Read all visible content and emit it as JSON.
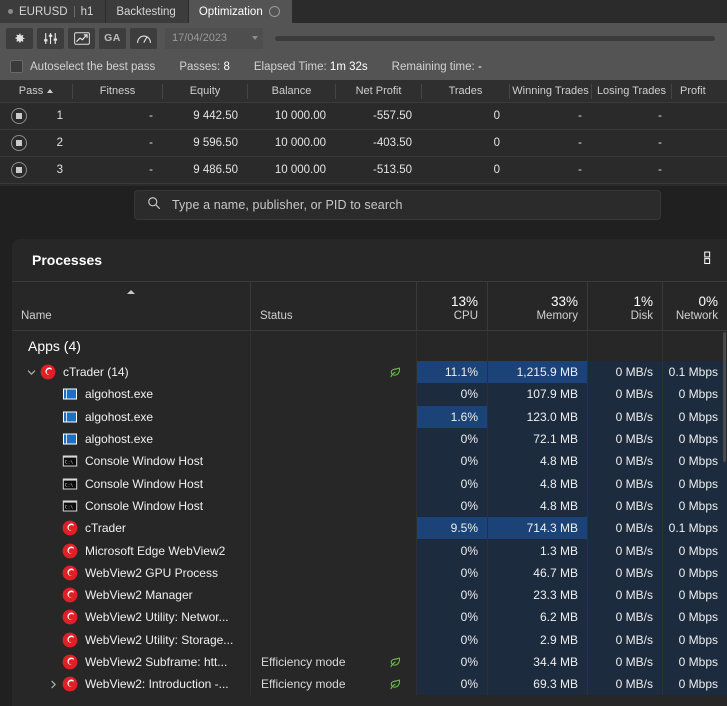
{
  "ctrader": {
    "tabs": [
      {
        "label": "EURUSD",
        "sub": "h1",
        "type": "symbol",
        "active": false
      },
      {
        "label": "Backtesting",
        "active": false
      },
      {
        "label": "Optimization",
        "active": true,
        "spinner": true
      }
    ],
    "toolbar": {
      "buttons": [
        {
          "name": "settings-button",
          "icon": "gear-icon",
          "label": ""
        },
        {
          "name": "parameters-button",
          "icon": "sliders-icon",
          "label": ""
        },
        {
          "name": "chart-button",
          "icon": "chart-line-icon",
          "label": ""
        },
        {
          "name": "ga-button",
          "icon": "text-icon",
          "label": "GA"
        },
        {
          "name": "gauge-button",
          "icon": "gauge-icon",
          "label": ""
        }
      ],
      "date_value": "17/04/2023"
    },
    "status": {
      "autoselect_label": "Autoselect the best pass",
      "passes_label": "Passes:",
      "passes_value": "8",
      "elapsed_label": "Elapsed Time:",
      "elapsed_value": "1m 32s",
      "remaining_label": "Remaining time:",
      "remaining_value": "-"
    },
    "table": {
      "columns": [
        "Pass",
        "Fitness",
        "Equity",
        "Balance",
        "Net Profit",
        "Trades",
        "Winning Trades",
        "Losing Trades",
        "Profit"
      ],
      "sort_column": "Pass",
      "sort_direction": "ascending",
      "rows": [
        {
          "pass": "1",
          "fitness": "-",
          "equity": "9 442.50",
          "balance": "10 000.00",
          "net_profit": "-557.50",
          "trades": "0",
          "winning_trades": "-",
          "losing_trades": "-",
          "profit": ""
        },
        {
          "pass": "2",
          "fitness": "-",
          "equity": "9 596.50",
          "balance": "10 000.00",
          "net_profit": "-403.50",
          "trades": "0",
          "winning_trades": "-",
          "losing_trades": "-",
          "profit": ""
        },
        {
          "pass": "3",
          "fitness": "-",
          "equity": "9 486.50",
          "balance": "10 000.00",
          "net_profit": "-513.50",
          "trades": "0",
          "winning_trades": "-",
          "losing_trades": "-",
          "profit": ""
        }
      ]
    }
  },
  "taskmanager": {
    "search": {
      "placeholder": "Type a name, publisher, or PID to search",
      "value": ""
    },
    "panel_title": "Processes",
    "columns": [
      {
        "key": "name",
        "label": "Name",
        "pct": ""
      },
      {
        "key": "status",
        "label": "Status",
        "pct": ""
      },
      {
        "key": "cpu",
        "label": "CPU",
        "pct": "13%"
      },
      {
        "key": "memory",
        "label": "Memory",
        "pct": "33%"
      },
      {
        "key": "disk",
        "label": "Disk",
        "pct": "1%"
      },
      {
        "key": "network",
        "label": "Network",
        "pct": "0%"
      }
    ],
    "rows": [
      {
        "type": "group",
        "name": "Apps (4)",
        "status": "",
        "cpu": "",
        "memory": "",
        "disk": "",
        "network": "",
        "cpu_hl": 0,
        "mem_hl": 0,
        "icon": "none",
        "indent": 0,
        "chevron": "none",
        "leaf": false
      },
      {
        "type": "process",
        "name": "cTrader (14)",
        "status": "",
        "cpu": "11.1%",
        "memory": "1,215.9 MB",
        "disk": "0 MB/s",
        "network": "0.1 Mbps",
        "cpu_hl": 3,
        "mem_hl": 3,
        "icon": "ctrader-icon",
        "indent": 0,
        "chevron": "expanded",
        "leaf": true
      },
      {
        "type": "process",
        "name": "algohost.exe",
        "status": "",
        "cpu": "0%",
        "memory": "107.9 MB",
        "disk": "0 MB/s",
        "network": "0 Mbps",
        "cpu_hl": 1,
        "mem_hl": 1,
        "icon": "app-window-icon",
        "indent": 1,
        "chevron": "none",
        "leaf": false
      },
      {
        "type": "process",
        "name": "algohost.exe",
        "status": "",
        "cpu": "1.6%",
        "memory": "123.0 MB",
        "disk": "0 MB/s",
        "network": "0 Mbps",
        "cpu_hl": 3,
        "mem_hl": 1,
        "icon": "app-window-icon",
        "indent": 1,
        "chevron": "none",
        "leaf": false
      },
      {
        "type": "process",
        "name": "algohost.exe",
        "status": "",
        "cpu": "0%",
        "memory": "72.1 MB",
        "disk": "0 MB/s",
        "network": "0 Mbps",
        "cpu_hl": 1,
        "mem_hl": 1,
        "icon": "app-window-icon",
        "indent": 1,
        "chevron": "none",
        "leaf": false
      },
      {
        "type": "process",
        "name": "Console Window Host",
        "status": "",
        "cpu": "0%",
        "memory": "4.8 MB",
        "disk": "0 MB/s",
        "network": "0 Mbps",
        "cpu_hl": 1,
        "mem_hl": 1,
        "icon": "console-icon",
        "indent": 1,
        "chevron": "none",
        "leaf": false
      },
      {
        "type": "process",
        "name": "Console Window Host",
        "status": "",
        "cpu": "0%",
        "memory": "4.8 MB",
        "disk": "0 MB/s",
        "network": "0 Mbps",
        "cpu_hl": 1,
        "mem_hl": 1,
        "icon": "console-icon",
        "indent": 1,
        "chevron": "none",
        "leaf": false
      },
      {
        "type": "process",
        "name": "Console Window Host",
        "status": "",
        "cpu": "0%",
        "memory": "4.8 MB",
        "disk": "0 MB/s",
        "network": "0 Mbps",
        "cpu_hl": 1,
        "mem_hl": 1,
        "icon": "console-icon",
        "indent": 1,
        "chevron": "none",
        "leaf": false
      },
      {
        "type": "process",
        "name": "cTrader",
        "status": "",
        "cpu": "9.5%",
        "memory": "714.3 MB",
        "disk": "0 MB/s",
        "network": "0.1 Mbps",
        "cpu_hl": 3,
        "mem_hl": 3,
        "icon": "ctrader-icon",
        "indent": 1,
        "chevron": "none",
        "leaf": false
      },
      {
        "type": "process",
        "name": "Microsoft Edge WebView2",
        "status": "",
        "cpu": "0%",
        "memory": "1.3 MB",
        "disk": "0 MB/s",
        "network": "0 Mbps",
        "cpu_hl": 1,
        "mem_hl": 1,
        "icon": "ctrader-icon",
        "indent": 1,
        "chevron": "none",
        "leaf": false
      },
      {
        "type": "process",
        "name": "WebView2 GPU Process",
        "status": "",
        "cpu": "0%",
        "memory": "46.7 MB",
        "disk": "0 MB/s",
        "network": "0 Mbps",
        "cpu_hl": 1,
        "mem_hl": 1,
        "icon": "ctrader-icon",
        "indent": 1,
        "chevron": "none",
        "leaf": false
      },
      {
        "type": "process",
        "name": "WebView2 Manager",
        "status": "",
        "cpu": "0%",
        "memory": "23.3 MB",
        "disk": "0 MB/s",
        "network": "0 Mbps",
        "cpu_hl": 1,
        "mem_hl": 1,
        "icon": "ctrader-icon",
        "indent": 1,
        "chevron": "none",
        "leaf": false
      },
      {
        "type": "process",
        "name": "WebView2 Utility: Networ...",
        "status": "",
        "cpu": "0%",
        "memory": "6.2 MB",
        "disk": "0 MB/s",
        "network": "0 Mbps",
        "cpu_hl": 1,
        "mem_hl": 1,
        "icon": "ctrader-icon",
        "indent": 1,
        "chevron": "none",
        "leaf": false
      },
      {
        "type": "process",
        "name": "WebView2 Utility: Storage...",
        "status": "",
        "cpu": "0%",
        "memory": "2.9 MB",
        "disk": "0 MB/s",
        "network": "0 Mbps",
        "cpu_hl": 1,
        "mem_hl": 1,
        "icon": "ctrader-icon",
        "indent": 1,
        "chevron": "none",
        "leaf": false
      },
      {
        "type": "process",
        "name": "WebView2 Subframe: htt...",
        "status": "Efficiency mode",
        "cpu": "0%",
        "memory": "34.4 MB",
        "disk": "0 MB/s",
        "network": "0 Mbps",
        "cpu_hl": 1,
        "mem_hl": 1,
        "icon": "ctrader-icon",
        "indent": 1,
        "chevron": "none",
        "leaf": true
      },
      {
        "type": "process",
        "name": "WebView2: Introduction -...",
        "status": "Efficiency mode",
        "cpu": "0%",
        "memory": "69.3 MB",
        "disk": "0 MB/s",
        "network": "0 Mbps",
        "cpu_hl": 1,
        "mem_hl": 1,
        "icon": "ctrader-icon",
        "indent": 1,
        "chevron": "collapsed",
        "leaf": true
      }
    ]
  },
  "colors": {
    "ctrader_chrome": "#545454",
    "taskman_bg": "#202020",
    "panel_bg": "#272727",
    "highlight_strong": "#1b4378",
    "highlight_weak": "#1d2b3e",
    "efficiency_green": "#6cc04a",
    "ctrader_red": "#e01f26"
  }
}
